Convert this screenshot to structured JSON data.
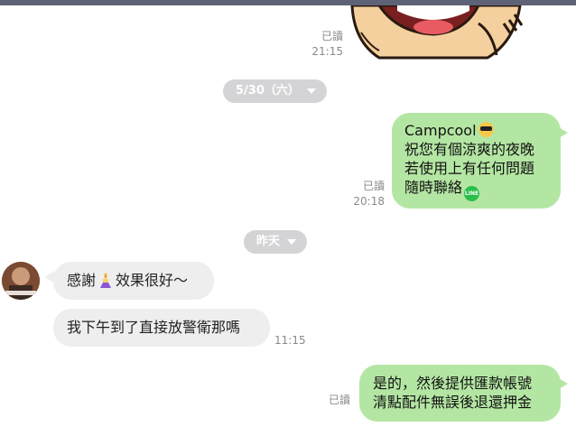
{
  "messages": {
    "sticker_read": "已讀",
    "sticker_time": "21:15",
    "date_1": "5/30（六）",
    "campcool_title": "Campcool",
    "campcool_line1": "祝您有個涼爽的夜晚",
    "campcool_line2": "若使用上有任何問題",
    "campcool_line3": "隨時聯絡",
    "campcool_read": "已讀",
    "campcool_time": "20:18",
    "date_2": "昨天",
    "customer_msg1_a": "感謝",
    "customer_msg1_b": "效果很好～",
    "customer_msg2": "我下午到了直接放警衛那嗎",
    "customer_time": "11:15",
    "reply_line1": "是的，然後提供匯款帳號",
    "reply_line2": "清點配件無誤後退還押金",
    "reply_read": "已讀"
  },
  "icons": {
    "line_icon_text": "LINE"
  },
  "colors": {
    "outgoing_bubble": "#b4e6a3",
    "incoming_bubble": "#eeeeef",
    "date_pill": "#d4d4d6",
    "top_bar": "#5d6277"
  }
}
